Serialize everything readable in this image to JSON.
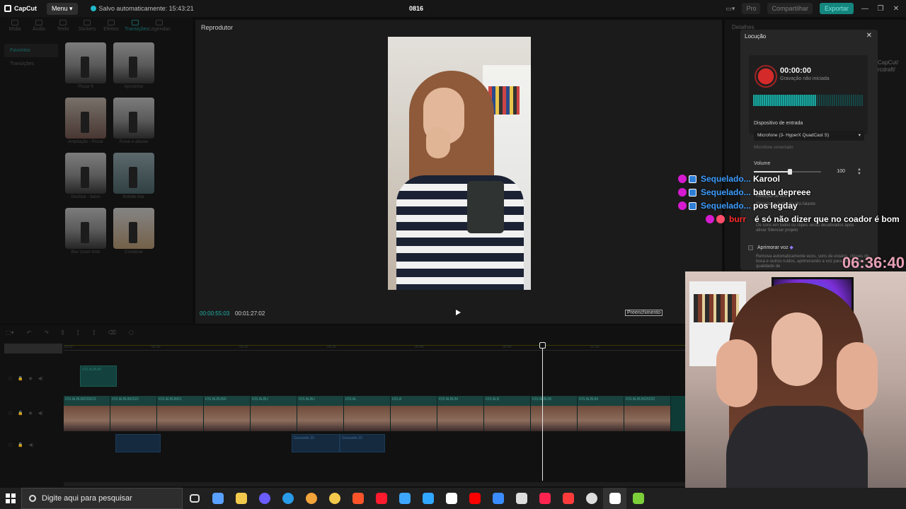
{
  "titlebar": {
    "app_logo": "CapCut",
    "menu_label": "Menu",
    "autosave_text": "Salvo automaticamente: 15:43:21",
    "project_title": "0816",
    "pro_label": "Pro",
    "share_label": "Compartilhar",
    "export_label": "Exportar",
    "window_controls": [
      "—",
      "❐",
      "✕"
    ]
  },
  "left_panel": {
    "tools": [
      "Mídia",
      "Áudio",
      "Texto",
      "Stickers",
      "Efeitos",
      "Transições",
      "Legendas"
    ],
    "active_tool": "Transições",
    "side_items": [
      "Favoritos",
      "Transições"
    ],
    "thumbs": [
      {
        "label": "Piscar II"
      },
      {
        "label": "Aproximar"
      },
      {
        "label": "Ampliação - Piscar"
      },
      {
        "label": "Puxar e afastar"
      },
      {
        "label": "Deslizar - baixo"
      },
      {
        "label": "Bobble blur"
      },
      {
        "label": "Blur zoom forte"
      },
      {
        "label": "Combinar"
      }
    ]
  },
  "player": {
    "title": "Reprodutor",
    "time_current": "00:00:55:03",
    "time_total": "00:01:27:02",
    "fill_label": "Preenchimento"
  },
  "details": {
    "title": "Detalhes",
    "side_fragment": [
      "CapCut/",
      "rcdraft/"
    ]
  },
  "locucao": {
    "title": "Locução",
    "rec_time": "00:00:00",
    "rec_status": "Gravação não iniciada",
    "meter_level": 0.57,
    "device_label": "Dispositivo de entrada",
    "device_value": "Microfone (3- HyperX QuadCast S)",
    "mic_status": "Microfone conectado",
    "volume_label": "Volume",
    "volume_value": "100",
    "volume_level": 0.5,
    "opt_noise": "Redução de eco",
    "opt_speaker": "Silenciar o áudio do alto-falante",
    "opt_mute_desc": "Os sons em todos os clipes serão desativados após ativar Silenciar projeto",
    "enhance_label": "Aprimorar voz",
    "enhance_desc": "Remova automaticamente ecos, sons de estalos, cliques de boca e outros ruídos, aprimorando a voz para obter uma qualidade de"
  },
  "timeline": {
    "ruler_ticks": [
      "00:00",
      "00:10",
      "00:20",
      "00:30",
      "00:40",
      "00:50",
      "01:00"
    ],
    "small_clip": "IOS ALBUM",
    "main_segments": [
      "IOS ALBUM220623",
      "IOS ALBUM2022",
      "IOS ALBUM01",
      "IOS ALBUM0",
      "IOS ALBU",
      "IOS ALBU",
      "IOS AL",
      "IOS A",
      "IOS ALBUM",
      "IOS ALB",
      "IOS ALBUM",
      "IOS ALBUM",
      "IOS ALBUM20230"
    ],
    "audio_clips": [
      "",
      "Gravando 20",
      "Gravando 22"
    ]
  },
  "chat": [
    {
      "user": "Sequelado...",
      "message": "Karool",
      "user_color": "#3c9cff"
    },
    {
      "user": "Sequelado...",
      "message": "bateu depreee",
      "user_color": "#3c9cff"
    },
    {
      "user": "Sequelado...",
      "message": "pos legday",
      "user_color": "#3c9cff"
    },
    {
      "user": "burr",
      "message": "é só não dizer que no coador é bom",
      "user_color": "#ff2b2b"
    }
  ],
  "stream_clock": "06:36:40",
  "taskbar": {
    "search_placeholder": "Digite aqui para pesquisar",
    "icons": [
      "task-view-icon",
      "copilot-icon",
      "file-explorer-icon",
      "cortana-icon",
      "edge-icon",
      "chrome-icon",
      "chrome-canary-icon",
      "brave-icon",
      "opera-icon",
      "app-icon",
      "photoshop-icon",
      "capcut-icon",
      "youtube-icon",
      "store-icon",
      "notepad-icon",
      "opera-gx-icon",
      "voicemod-icon",
      "obs-icon",
      "capcut-active-icon",
      "winamp-icon"
    ],
    "icon_colors": [
      "#dddddd",
      "#5aa0ff",
      "#f2c94c",
      "#6a5cff",
      "#2a9be8",
      "#f2a33a",
      "#f2c94c",
      "#fb542b",
      "#ff1b2d",
      "#3da6ff",
      "#31a8ff",
      "#ffffff",
      "#ff0000",
      "#3a8cff",
      "#dddddd",
      "#ff2450",
      "#ff3b3b",
      "#dddddd",
      "#ffffff",
      "#7ccf3a"
    ]
  }
}
